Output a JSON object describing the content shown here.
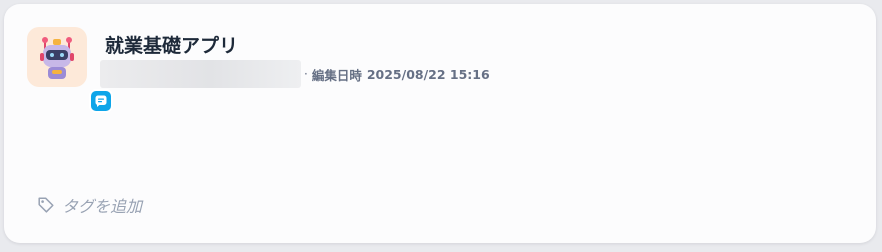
{
  "app": {
    "title": "就業基礎アプリ",
    "meta_separator": "·",
    "edit_label": "編集日時",
    "edit_time": "2025/08/22 15:16",
    "icon": "robot-icon",
    "badge_icon": "chat-bubble-icon"
  },
  "tags": {
    "add_label": "タグを追加",
    "icon": "tag-icon"
  },
  "colors": {
    "icon_background": "#fde9d9",
    "badge": "#0ea5e9",
    "title_text": "#1d2939",
    "meta_text": "#667085",
    "tag_text": "#98a2b3"
  }
}
